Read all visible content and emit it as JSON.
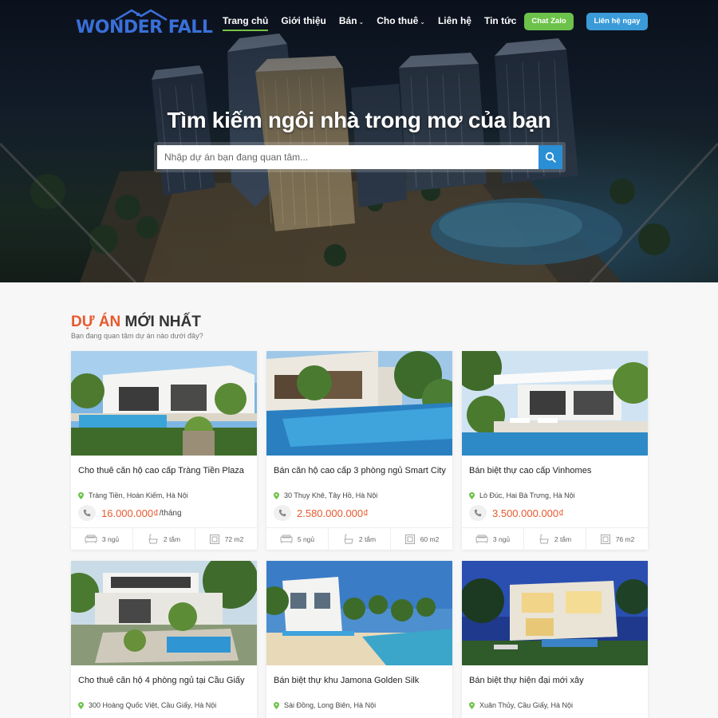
{
  "header": {
    "logo_text": "WONDER FALL",
    "nav": [
      {
        "label": "Trang chủ",
        "active": true,
        "has_dropdown": false
      },
      {
        "label": "Giới thiệu",
        "active": false,
        "has_dropdown": false
      },
      {
        "label": "Bán",
        "active": false,
        "has_dropdown": true
      },
      {
        "label": "Cho thuê",
        "active": false,
        "has_dropdown": true
      },
      {
        "label": "Liên hệ",
        "active": false,
        "has_dropdown": false
      },
      {
        "label": "Tin tức",
        "active": false,
        "has_dropdown": false
      }
    ],
    "zalo_label": "Chat Zalo",
    "contact_label": "Liên hệ ngay"
  },
  "hero": {
    "title": "Tìm kiếm ngôi nhà trong mơ của bạn",
    "search_placeholder": "Nhập dự án bạn đang quan tâm..."
  },
  "section": {
    "title_accent": "DỰ ÁN",
    "title_rest": " MỚI NHẤT",
    "subtitle": "Bạn đang quan tâm dự án nào dưới đây?"
  },
  "listings": [
    {
      "title": "Cho thuê căn hộ cao cấp Tràng Tiền Plaza",
      "address": "Tràng Tiền, Hoàn Kiếm, Hà Nội",
      "price": "16.000.000₫",
      "unit": "/tháng",
      "beds": "3 ngủ",
      "baths": "2 tắm",
      "area": "72 m2",
      "photo": "villa-pool-white"
    },
    {
      "title": "Bán căn hộ cao cấp 3 phòng ngủ Smart City",
      "address": "30 Thụy Khê, Tây Hồ, Hà Nội",
      "price": "2.580.000.000₫",
      "unit": "",
      "beds": "5 ngủ",
      "baths": "2 tắm",
      "area": "60 m2",
      "photo": "resort-pool-long"
    },
    {
      "title": "Bán biệt thự cao cấp Vinhomes",
      "address": "Lò Đúc, Hai Bà Trưng, Hà Nội",
      "price": "3.500.000.000₫",
      "unit": "",
      "beds": "3 ngủ",
      "baths": "2 tắm",
      "area": "76 m2",
      "photo": "modern-villa-pool"
    },
    {
      "title": "Cho thuê căn hộ 4 phòng ngủ tại Cầu Giấy",
      "address": "300 Hoàng Quốc Việt, Cầu Giấy, Hà Nội",
      "price": "",
      "unit": "",
      "beds": "",
      "baths": "",
      "area": "",
      "photo": "modern-house-garden"
    },
    {
      "title": "Bán biệt thự khu Jamona Golden Silk",
      "address": "Sài Đồng, Long Biên, Hà Nội",
      "price": "",
      "unit": "",
      "beds": "",
      "baths": "",
      "area": "",
      "photo": "beach-villa"
    },
    {
      "title": "Bán biệt thự hiện đại mới xây",
      "address": "Xuân Thủy, Cầu Giấy, Hà Nội",
      "price": "",
      "unit": "",
      "beds": "",
      "baths": "",
      "area": "",
      "photo": "night-villa"
    }
  ],
  "colors": {
    "accent": "#e8592e",
    "nav_active": "#7ac143",
    "zalo": "#6cc24a",
    "contact": "#3b9bd9",
    "search_btn": "#2a8fd4",
    "logo": "#3a6fd8"
  }
}
